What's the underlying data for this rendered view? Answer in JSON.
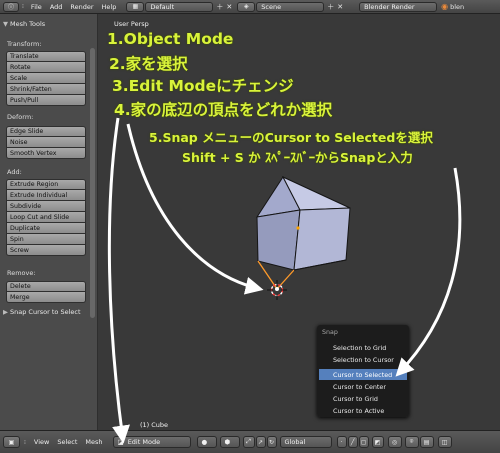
{
  "topbar": {
    "menus": [
      "File",
      "Add",
      "Render",
      "Help"
    ],
    "screen_layout": "Default",
    "scene": "Scene",
    "render_engine": "Blender Render",
    "truncated_right": "blen"
  },
  "shelf": {
    "panel_title": "Mesh Tools",
    "sections": {
      "transform": "Transform:",
      "deform": "Deform:",
      "add": "Add:",
      "remove": "Remove:"
    },
    "transform_tools": [
      "Translate",
      "Rotate",
      "Scale",
      "Shrink/Fatten",
      "Push/Pull"
    ],
    "deform_tools": [
      "Edge Slide",
      "Noise",
      "Smooth Vertex"
    ],
    "add_tools": [
      "Extrude Region",
      "Extrude Individual",
      "Subdivide",
      "Loop Cut and Slide",
      "Duplicate",
      "Spin",
      "Screw"
    ],
    "remove_tools": [
      "Delete",
      "Merge"
    ],
    "operator_panel": "Snap Cursor to Select"
  },
  "viewport": {
    "view_name": "User Persp",
    "object_info": "(1) Cube"
  },
  "snap_menu": {
    "title": "Snap",
    "items": [
      "Selection to Grid",
      "Selection to Cursor",
      "Cursor to Selected",
      "Cursor to Center",
      "Cursor to Grid",
      "Cursor to Active"
    ],
    "active_index": 2
  },
  "bottombar": {
    "menus": [
      "View",
      "Select",
      "Mesh"
    ],
    "mode": "Edit Mode",
    "orientation": "Global"
  },
  "annotations": {
    "step1": "1.Object Mode",
    "step2": "2.家を選択",
    "step3": "3.Edit Modeにチェンジ",
    "step4": "4.家の底辺の頂点をどれか選択",
    "step5": "5.Snap メニューのCursor to Selectedを選択",
    "step5_sub": "Shift + S か ｽﾍﾟｰｽﾊﾞｰからSnapと入力"
  },
  "colors": {
    "annotation": "#d9f33b",
    "menu_highlight": "#5580bd",
    "selected_edge": "#ff9a2a"
  }
}
